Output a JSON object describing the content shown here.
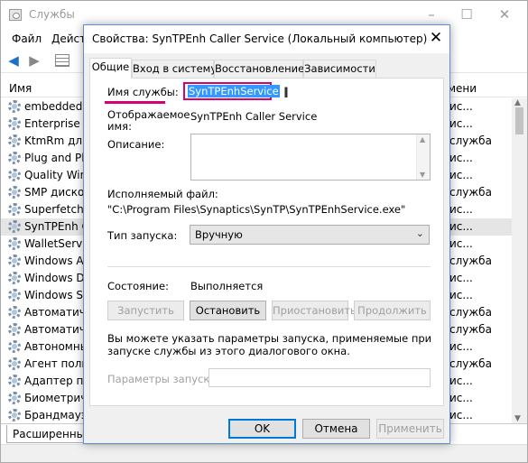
{
  "services_window": {
    "title": "Службы",
    "menu": [
      "Файл",
      "Действ"
    ],
    "column_name": "Имя",
    "column_startup": "мени",
    "extended_tab": "Расширенный",
    "rows": [
      {
        "name": "embeddedm",
        "startup": "ис..."
      },
      {
        "name": "Enterprise Ap",
        "startup": "ис..."
      },
      {
        "name": "KtmRm для и",
        "startup": "служба"
      },
      {
        "name": "Plug and Play",
        "startup": "ис..."
      },
      {
        "name": "Quality Wind",
        "startup": "ис..."
      },
      {
        "name": "SMP дисков",
        "startup": "служба"
      },
      {
        "name": "Superfetch",
        "startup": "ис..."
      },
      {
        "name": "SynTPEnh Ca",
        "startup": "ис..."
      },
      {
        "name": "WalletService",
        "startup": "ис..."
      },
      {
        "name": "Windows Au",
        "startup": "служба"
      },
      {
        "name": "Windows Dri",
        "startup": "ис..."
      },
      {
        "name": "Windows Sea",
        "startup": "ис..."
      },
      {
        "name": "Автоматиче",
        "startup": "служба"
      },
      {
        "name": "Автоматиче",
        "startup": "служба"
      },
      {
        "name": "Автономные",
        "startup": "ис..."
      },
      {
        "name": "Агент полит",
        "startup": "служба"
      },
      {
        "name": "Адаптер про",
        "startup": "ис..."
      },
      {
        "name": "Биометриче",
        "startup": "ис..."
      },
      {
        "name": "Брандмауэр",
        "startup": "ис..."
      }
    ]
  },
  "dialog": {
    "title": "Свойства: SynTPEnh Caller Service (Локальный компьютер)",
    "tabs": [
      "Общие",
      "Вход в систему",
      "Восстановление",
      "Зависимости"
    ],
    "service_name_label": "Имя службы:",
    "service_name_value": "SynTPEnhService",
    "display_name_label": "Отображаемое имя:",
    "display_name_value": "SynTPEnh Caller Service",
    "description_label": "Описание:",
    "executable_label": "Исполняемый файл:",
    "executable_value": "\"C:\\Program Files\\Synaptics\\SynTP\\SynTPEnhService.exe\"",
    "startup_type_label": "Тип запуска:",
    "startup_type_value": "Вручную",
    "state_label": "Состояние:",
    "state_value": "Выполняется",
    "buttons": {
      "start": "Запустить",
      "stop": "Остановить",
      "pause": "Приостановить",
      "resume": "Продолжить"
    },
    "info_text": "Вы можете указать параметры запуска, применяемые при запуске службы из этого диалогового окна.",
    "params_label": "Параметры запуска:",
    "params_value": "",
    "ok": "OK",
    "cancel": "Отмена",
    "apply": "Применить"
  },
  "colors": {
    "highlight_magenta": "#d6006f",
    "selection_blue": "#3399ff",
    "dialog_border": "#5b8fd6"
  }
}
